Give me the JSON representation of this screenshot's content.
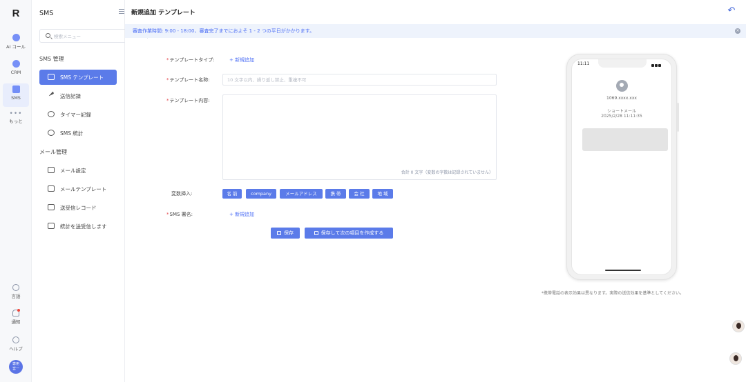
{
  "rail": {
    "logo": "R",
    "items": [
      {
        "label": "AI コール",
        "icon": "ai-call-icon"
      },
      {
        "label": "CRM",
        "icon": "crm-icon"
      },
      {
        "label": "SMS",
        "icon": "sms-icon"
      },
      {
        "label": "もっと",
        "icon": "more-icon"
      }
    ],
    "bottom": [
      {
        "label": "言語",
        "icon": "globe-icon"
      },
      {
        "label": "通知",
        "icon": "bell-icon"
      },
      {
        "label": "ヘルプ",
        "icon": "help-icon"
      }
    ],
    "avatar_text_1": "専用",
    "avatar_text_2": "営一"
  },
  "menu": {
    "title": "SMS",
    "search_placeholder": "検索メニュー",
    "section_sms": "SMS 管理",
    "sms_items": [
      {
        "label": "SMS テンプレート",
        "icon": "message-icon"
      },
      {
        "label": "送信記録",
        "icon": "send-icon"
      },
      {
        "label": "タイマー記録",
        "icon": "clock-icon"
      },
      {
        "label": "SMS 統計",
        "icon": "chart-icon"
      }
    ],
    "section_mail": "メール管理",
    "mail_items": [
      {
        "label": "メール設定",
        "icon": "mail-icon"
      },
      {
        "label": "メールテンプレート",
        "icon": "mail-template-icon"
      },
      {
        "label": "送受信レコード",
        "icon": "mail-record-icon"
      },
      {
        "label": "統計を送受信します",
        "icon": "mail-stats-icon"
      }
    ]
  },
  "header": {
    "title": "新規追加 テンプレート",
    "notice": "審査作業時間: 9:00 - 18:00、審査完了までにおよそ 1 - 2 つの平日がかかります。"
  },
  "form": {
    "type_label": "テンプレートタイプ:",
    "type_add": "+ 新規追加",
    "name_label": "テンプレート名称:",
    "name_placeholder": "10 文字以内、繰り返し禁止、重複不可",
    "content_label": "テンプレート内容:",
    "char_count": "合計 0 文字（変数の字数は記録されていません）",
    "variable_label": "変数挿入:",
    "variables": [
      "名 前",
      "company",
      "メールアドレス",
      "携 帯",
      "会 社",
      "地 域"
    ],
    "signature_label": "SMS 署名:",
    "signature_add": "+ 新規追加",
    "save_label": "保存",
    "save_next_label": "保存して次の項目を作成する"
  },
  "preview": {
    "time": "11:11",
    "number": "1069.xxxx.xxx",
    "sms_label": "ショートメール",
    "sms_time": "2025/2/28 11:11:35",
    "note": "*携帯電話の表示効果は異なります。実際の送信効果を基準としてください。"
  },
  "colors": {
    "accent": "#5b7be9",
    "notice_bg": "#eef3fc",
    "required": "#e5484d"
  }
}
